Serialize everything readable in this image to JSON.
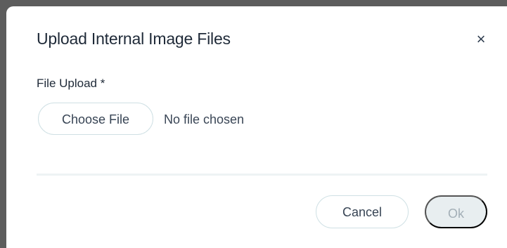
{
  "dialog": {
    "title": "Upload Internal Image Files",
    "close_glyph": "×",
    "close_icon": "close-icon"
  },
  "file_upload": {
    "label": "File Upload *",
    "choose_button_label": "Choose File",
    "status_text": "No file chosen"
  },
  "footer": {
    "cancel_label": "Cancel",
    "ok_label": "Ok",
    "ok_disabled": true
  },
  "colors": {
    "backdrop": "#5d5d5d",
    "dialog_background": "#ffffff",
    "title_text": "#1f2a38",
    "button_border": "#cfe0e4",
    "disabled_button_background": "#e8eef0",
    "disabled_button_text": "#a3afb7"
  }
}
